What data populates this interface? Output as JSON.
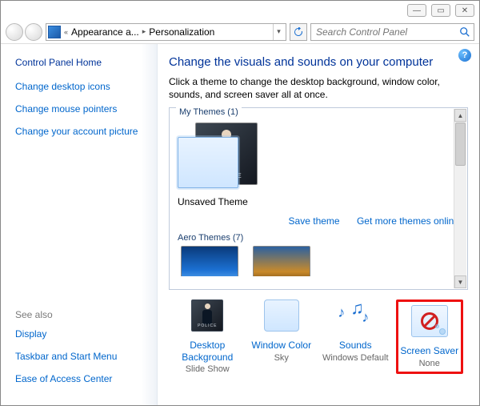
{
  "titlebar": {
    "min": "—",
    "max": "▭",
    "close": "✕"
  },
  "breadcrumb": {
    "seg1": "Appearance a...",
    "seg2": "Personalization"
  },
  "search": {
    "placeholder": "Search Control Panel"
  },
  "sidebar": {
    "home": "Control Panel Home",
    "links": {
      "desktop_icons": "Change desktop icons",
      "mouse_pointers": "Change mouse pointers",
      "account_picture": "Change your account picture"
    },
    "see_also": {
      "hdr": "See also",
      "display": "Display",
      "taskbar": "Taskbar and Start Menu",
      "ease": "Ease of Access Center"
    }
  },
  "main": {
    "title": "Change the visuals and sounds on your computer",
    "desc": "Click a theme to change the desktop background, window color, sounds, and screen saver all at once.",
    "mythemes_label": "My Themes (1)",
    "unsaved_theme": "Unsaved Theme",
    "save_theme": "Save theme",
    "more_online": "Get more themes online",
    "aero_label": "Aero Themes (7)"
  },
  "bottom": {
    "db": {
      "label": "Desktop Background",
      "sub": "Slide Show"
    },
    "wc": {
      "label": "Window Color",
      "sub": "Sky"
    },
    "snd": {
      "label": "Sounds",
      "sub": "Windows Default"
    },
    "ss": {
      "label": "Screen Saver",
      "sub": "None"
    }
  }
}
